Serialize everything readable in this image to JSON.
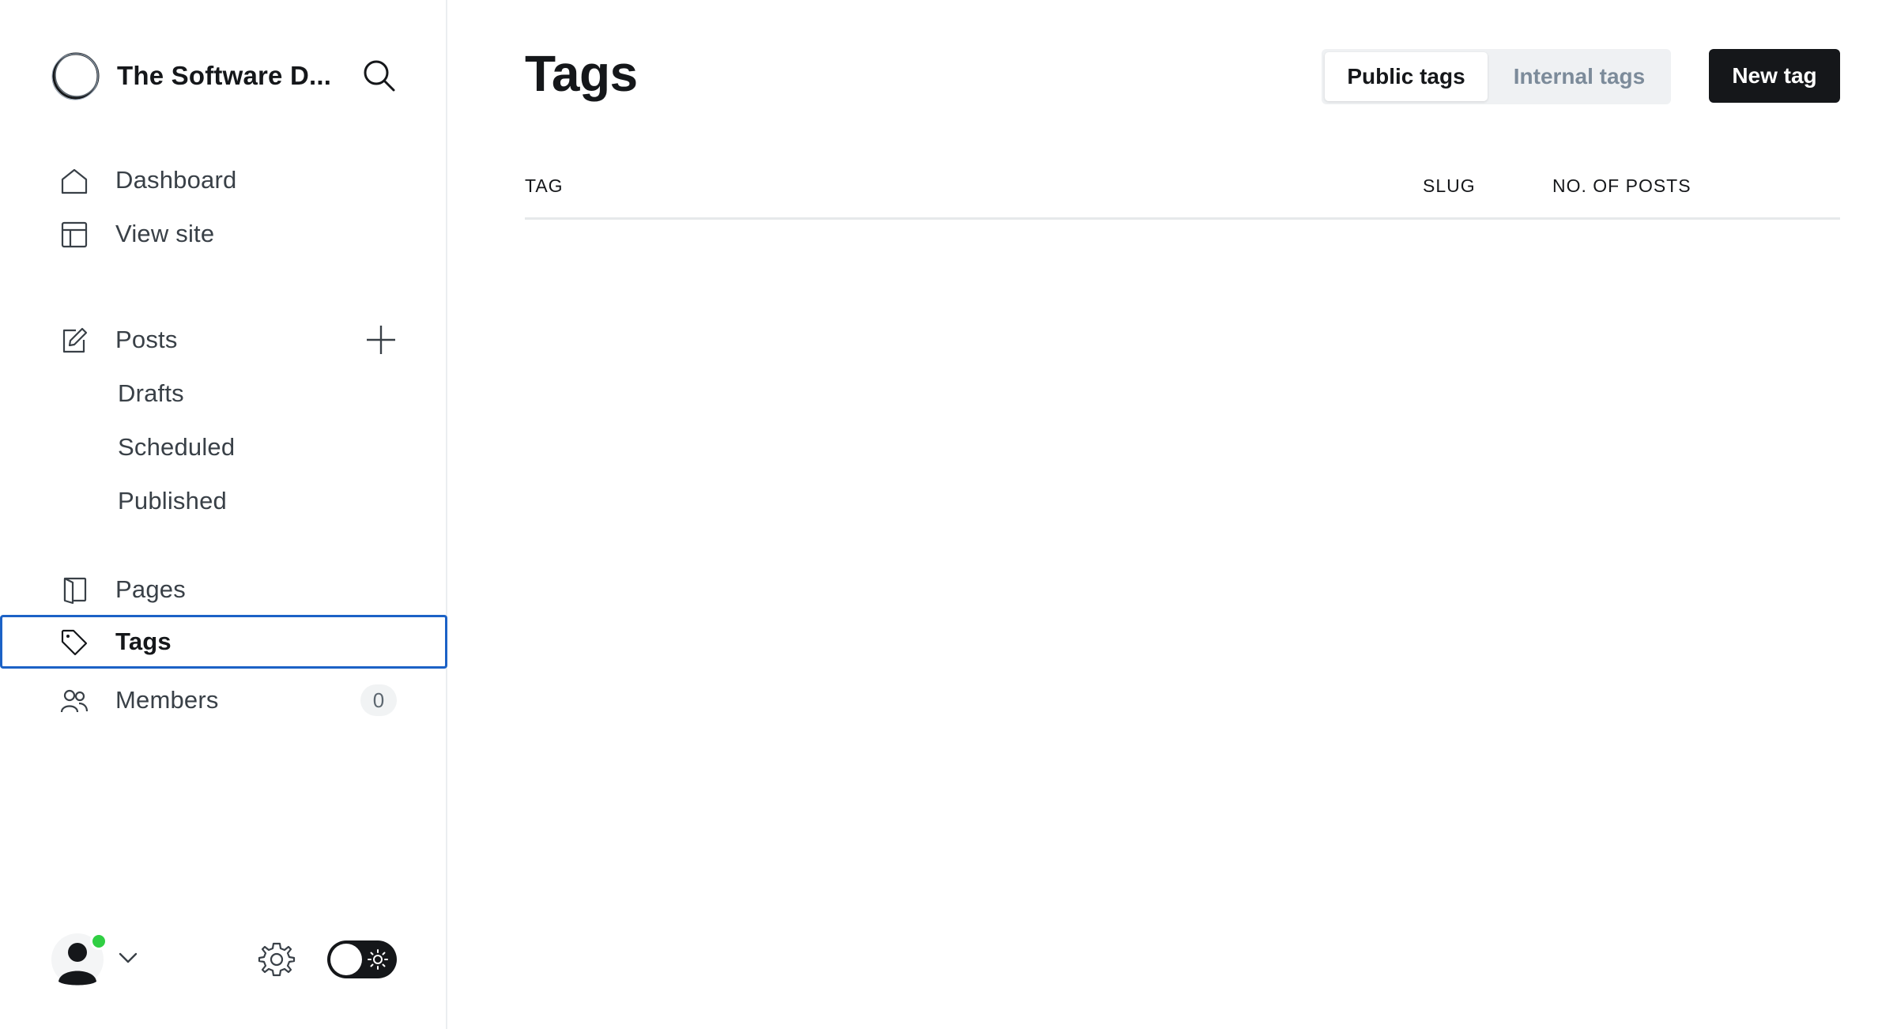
{
  "sidebar": {
    "site_name": "The Software D...",
    "nav": {
      "dashboard": "Dashboard",
      "view_site": "View site",
      "posts": "Posts",
      "drafts": "Drafts",
      "scheduled": "Scheduled",
      "published": "Published",
      "pages": "Pages",
      "tags": "Tags",
      "members": "Members",
      "members_count": "0"
    },
    "icons": [
      "logo-icon",
      "search-icon",
      "home-icon",
      "view-site-icon",
      "edit-icon",
      "plus-icon",
      "pages-icon",
      "tag-icon",
      "members-icon",
      "avatar-icon",
      "chevron-down-icon",
      "gear-icon",
      "sun-icon"
    ],
    "presence_color": "#30cf43",
    "active_item": "tags"
  },
  "main": {
    "title": "Tags",
    "tabs": [
      {
        "label": "Public tags",
        "active": true
      },
      {
        "label": "Internal tags",
        "active": false
      }
    ],
    "new_button": "New tag",
    "table": {
      "columns": [
        "TAG",
        "SLUG",
        "NO. OF POSTS"
      ],
      "rows": []
    }
  },
  "colors": {
    "primary_button": "#15171a",
    "active_outline": "#1c62c6",
    "inactive_tab_text": "#7c8b9a"
  }
}
